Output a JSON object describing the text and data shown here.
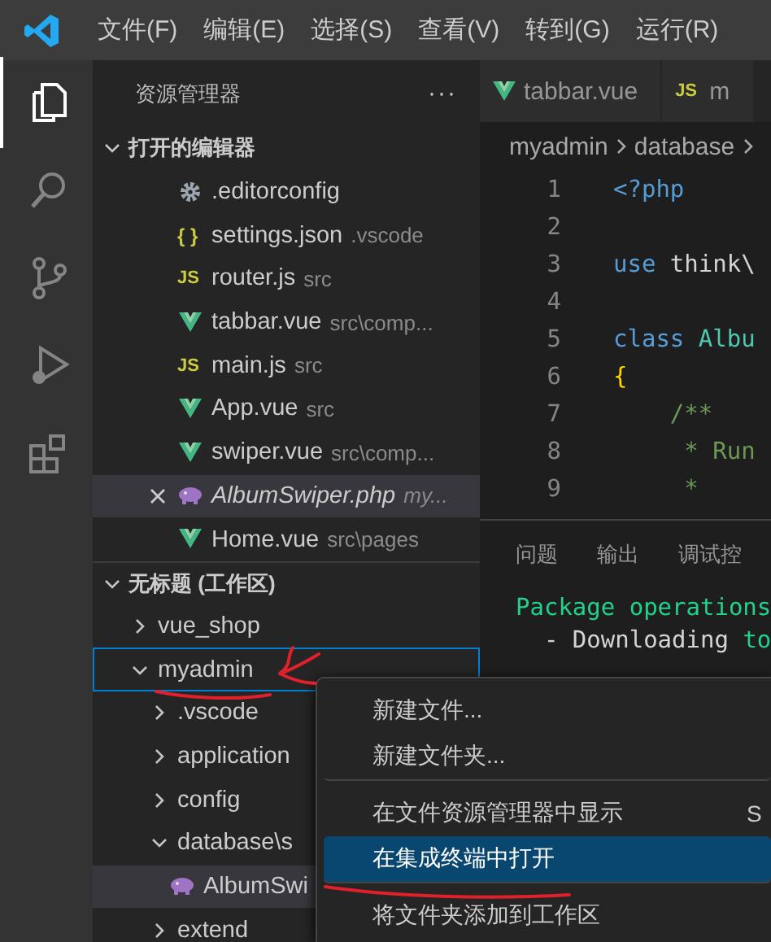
{
  "menu_bar": {
    "items": [
      "文件(F)",
      "编辑(E)",
      "选择(S)",
      "查看(V)",
      "转到(G)",
      "运行(R)"
    ]
  },
  "activity_bar": [
    {
      "kind": "files",
      "selected": true
    },
    {
      "kind": "search",
      "selected": false
    },
    {
      "kind": "branch",
      "selected": false
    },
    {
      "kind": "debug",
      "selected": false
    },
    {
      "kind": "blocks",
      "selected": false
    }
  ],
  "sidebar": {
    "title": "资源管理器",
    "more": "···",
    "open_editors": {
      "title": "打开的编辑器",
      "expanded": true,
      "items": [
        {
          "name": ".editorconfig",
          "kind": "gear",
          "selected": false,
          "preview": false
        },
        {
          "name": "settings.json",
          "description": ".vscode",
          "kind": "json",
          "icon_glyph": "{ }",
          "selected": false,
          "preview": false
        },
        {
          "name": "router.js",
          "description": "src",
          "kind": "js",
          "icon_glyph": "JS",
          "selected": false,
          "preview": false
        },
        {
          "name": "tabbar.vue",
          "description": "src\\comp...",
          "kind": "vue",
          "selected": false,
          "preview": false
        },
        {
          "name": "main.js",
          "description": "src",
          "kind": "js",
          "icon_glyph": "JS",
          "selected": false,
          "preview": false
        },
        {
          "name": "App.vue",
          "description": "src",
          "kind": "vue",
          "selected": false,
          "preview": false
        },
        {
          "name": "swiper.vue",
          "description": "src\\comp...",
          "kind": "vue",
          "selected": false,
          "preview": false
        },
        {
          "name": "AlbumSwiper.php",
          "description": "my...",
          "kind": "php",
          "selected": true,
          "preview": true
        },
        {
          "name": "Home.vue",
          "description": "src\\pages",
          "kind": "vue",
          "selected": false,
          "preview": false
        }
      ]
    },
    "workspace": {
      "title": "无标题 (工作区)",
      "expanded": true,
      "children": [
        {
          "name": "vue_shop",
          "kind": "folder",
          "expanded": false,
          "selected": false,
          "focused": false
        },
        {
          "name": "myadmin",
          "kind": "folder",
          "expanded": true,
          "selected": false,
          "focused": true,
          "children": [
            {
              "name": ".vscode",
              "kind": "folder",
              "expanded": false,
              "selected": false,
              "focused": false
            },
            {
              "name": "application",
              "kind": "folder",
              "expanded": false,
              "selected": false,
              "focused": false
            },
            {
              "name": "config",
              "kind": "folder",
              "expanded": false,
              "selected": false,
              "focused": false
            },
            {
              "name": "database\\s",
              "kind": "folder",
              "expanded": true,
              "selected": false,
              "focused": false,
              "children": [
                {
                  "name": "AlbumSwi",
                  "kind": "php",
                  "selected": true,
                  "focused": false
                }
              ]
            },
            {
              "name": "extend",
              "kind": "folder",
              "expanded": false,
              "selected": false,
              "focused": false
            }
          ]
        }
      ]
    }
  },
  "editor": {
    "tabs": [
      {
        "label": "tabbar.vue",
        "kind": "vue",
        "selected": false
      },
      {
        "label": "m",
        "kind": "js",
        "icon_glyph": "JS",
        "selected": false
      }
    ],
    "breadcrumb": [
      "myadmin",
      "database"
    ],
    "lines": [
      {
        "number": "1",
        "tokens": [
          {
            "text": "<?php",
            "kind": "keyword"
          }
        ]
      },
      {
        "number": "2"
      },
      {
        "number": "3",
        "tokens": [
          {
            "text": "use",
            "kind": "keyword"
          },
          {
            "text": " think\\",
            "kind": "plain"
          }
        ]
      },
      {
        "number": "4"
      },
      {
        "number": "5",
        "tokens": [
          {
            "text": "class ",
            "kind": "keyword"
          },
          {
            "text": "Albu",
            "kind": "type"
          }
        ]
      },
      {
        "number": "6",
        "tokens": [
          {
            "text": "{",
            "kind": "bracket"
          }
        ]
      },
      {
        "number": "7",
        "tokens": [
          {
            "text": "    /**",
            "kind": "comment"
          }
        ]
      },
      {
        "number": "8",
        "tokens": [
          {
            "text": "     * Run",
            "kind": "comment"
          }
        ]
      },
      {
        "number": "9",
        "tokens": [
          {
            "text": "     *",
            "kind": "comment"
          }
        ]
      }
    ]
  },
  "panel": {
    "tabs": [
      {
        "label": "问题",
        "selected": false
      },
      {
        "label": "输出",
        "selected": false
      },
      {
        "label": "调试控",
        "selected": false
      }
    ],
    "terminal": [
      {
        "segments": [
          {
            "text": "Package operations",
            "kind": "success"
          }
        ]
      },
      {
        "segments": [
          {
            "text": "  - Downloading ",
            "kind": "plain"
          },
          {
            "text": "to",
            "kind": "success"
          }
        ]
      }
    ]
  },
  "context_menu": {
    "items": [
      {
        "label": "新建文件...",
        "selected": false,
        "separator_after": false
      },
      {
        "label": "新建文件夹...",
        "selected": false,
        "separator_after": true
      },
      {
        "label": "在文件资源管理器中显示",
        "shortcut": "S",
        "selected": false,
        "separator_after": false
      },
      {
        "label": "在集成终端中打开",
        "selected": true,
        "separator_after": true
      },
      {
        "label": "将文件夹添加到工作区",
        "selected": false,
        "separator_after": false
      }
    ]
  }
}
